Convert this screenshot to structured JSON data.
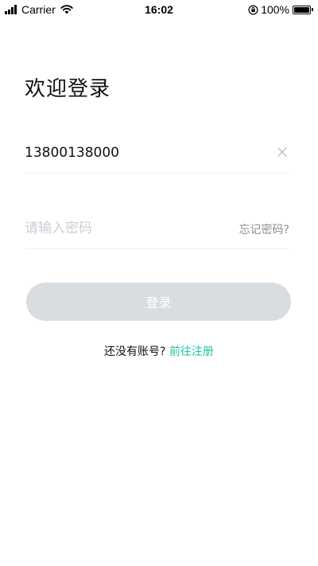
{
  "status_bar": {
    "carrier": "Carrier",
    "time": "16:02",
    "battery": "100%"
  },
  "login": {
    "title": "欢迎登录",
    "phone_value": "13800138000",
    "password_placeholder": "请输入密码",
    "forgot_password": "忘记密码?",
    "login_button": "登录",
    "no_account_prompt": "还没有账号?",
    "register_link": "前往注册"
  },
  "colors": {
    "accent": "#1cc6a0",
    "button_disabled": "#d8dde2",
    "placeholder": "#c9ced6"
  }
}
